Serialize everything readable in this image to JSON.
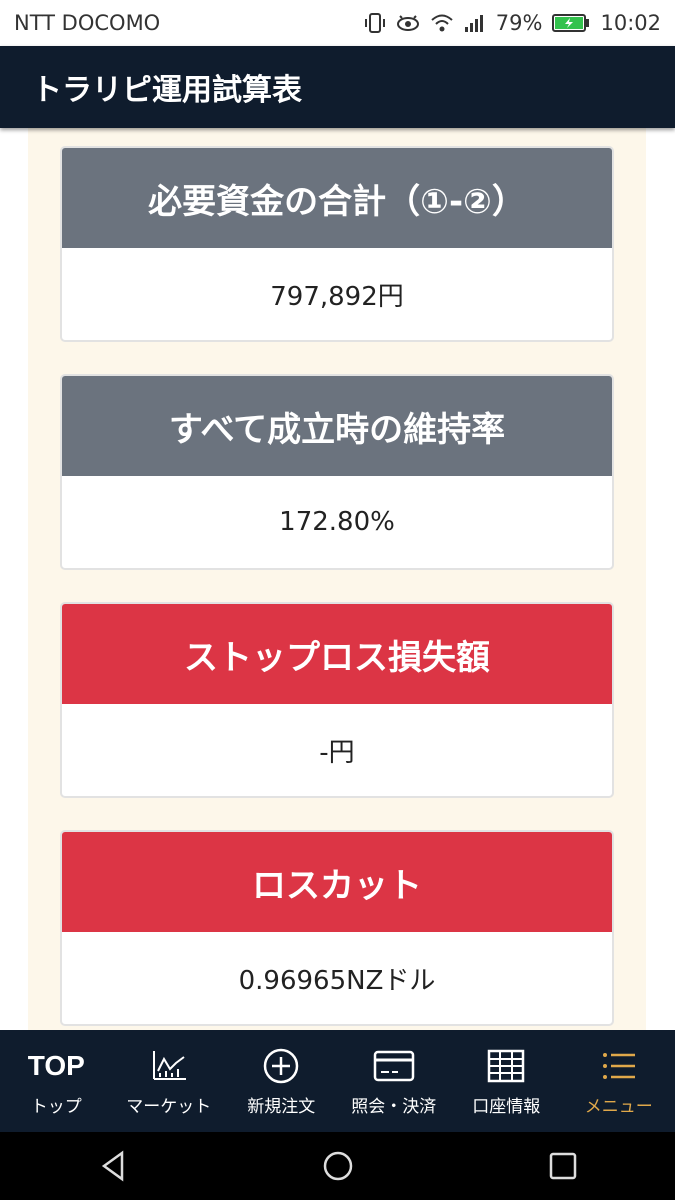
{
  "status_bar": {
    "carrier": "NTT DOCOMO",
    "battery": "79%",
    "time": "10:02"
  },
  "app_bar": {
    "title": "トラリピ運用試算表"
  },
  "cards": [
    {
      "title": "必要資金の合計（①-②）",
      "value": "797,892円",
      "color": "#6b737e"
    },
    {
      "title": "すべて成立時の維持率",
      "value": "172.80%",
      "color": "#6b737e"
    },
    {
      "title": "ストップロス損失額",
      "value": "-円",
      "color": "#dc3545"
    },
    {
      "title": "ロスカット",
      "value": "0.96965NZドル",
      "color": "#dc3545"
    }
  ],
  "tab_bar": {
    "items": [
      {
        "icon_text": "TOP",
        "label": "トップ",
        "icon": "top-text"
      },
      {
        "label": "マーケット",
        "icon": "chart-icon"
      },
      {
        "label": "新規注文",
        "icon": "plus-circle-icon"
      },
      {
        "label": "照会・決済",
        "icon": "card-icon"
      },
      {
        "label": "口座情報",
        "icon": "grid-icon"
      },
      {
        "label": "メニュー",
        "icon": "menu-icon",
        "active": true
      }
    ]
  },
  "colors": {
    "header": "#0f1c2d",
    "accent": "#e0a84a",
    "card_gray": "#6b737e",
    "card_red": "#dc3545",
    "background": "#fdf7ea"
  }
}
